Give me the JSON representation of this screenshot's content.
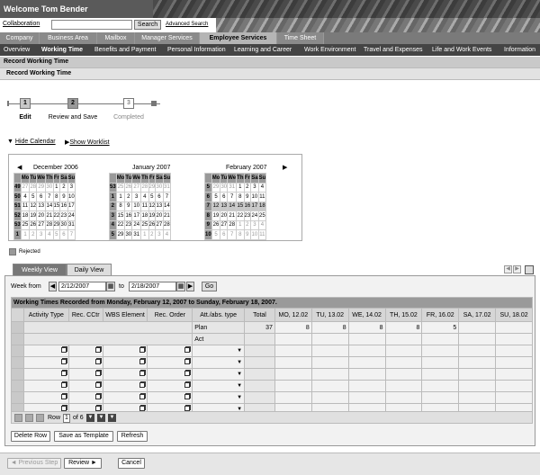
{
  "header": {
    "welcome": "Welcome Tom Bender"
  },
  "search": {
    "collaboration": "Collaboration",
    "button": "Search",
    "advanced": "Advanced Search"
  },
  "tabs": [
    "Company",
    "Business Area",
    "Mailbox",
    "Manager Services",
    "Employee Services",
    "Time Sheet"
  ],
  "subnav": [
    "Overview",
    "Working Time",
    "Benefits and Payment",
    "Personal Information",
    "Learning and Career",
    "Work Environment",
    "Travel and Expenses",
    "Life and Work Events",
    "Information"
  ],
  "page": {
    "title": "Record Working Time",
    "section": "Record Working Time"
  },
  "roadmap": {
    "steps": [
      {
        "num": "1",
        "label": "Edit"
      },
      {
        "num": "2",
        "label": "Review and Save"
      },
      {
        "num": "3",
        "label": "Completed"
      }
    ]
  },
  "links": {
    "hide_calendar": "Hide Calendar",
    "show_worklist": "Show Worklist"
  },
  "calendar": {
    "days": [
      "Mo",
      "Tu",
      "We",
      "Th",
      "Fr",
      "Sa",
      "Su"
    ],
    "months": [
      {
        "name": "December 2006",
        "weeks": [
          [
            "49",
            "27",
            "28",
            "29",
            "30",
            "1",
            "2",
            "3"
          ],
          [
            "50",
            "4",
            "5",
            "6",
            "7",
            "8",
            "9",
            "10"
          ],
          [
            "51",
            "11",
            "12",
            "13",
            "14",
            "15",
            "16",
            "17"
          ],
          [
            "52",
            "18",
            "19",
            "20",
            "21",
            "22",
            "23",
            "24"
          ],
          [
            "53",
            "25",
            "26",
            "27",
            "28",
            "29",
            "30",
            "31"
          ],
          [
            "1",
            "1",
            "2",
            "3",
            "4",
            "5",
            "6",
            "7"
          ]
        ]
      },
      {
        "name": "January 2007",
        "weeks": [
          [
            "53",
            "25",
            "26",
            "27",
            "28",
            "29",
            "30",
            "31"
          ],
          [
            "1",
            "1",
            "2",
            "3",
            "4",
            "5",
            "6",
            "7"
          ],
          [
            "2",
            "8",
            "9",
            "10",
            "11",
            "12",
            "13",
            "14"
          ],
          [
            "3",
            "15",
            "16",
            "17",
            "18",
            "19",
            "20",
            "21"
          ],
          [
            "4",
            "22",
            "23",
            "24",
            "25",
            "26",
            "27",
            "28"
          ],
          [
            "5",
            "29",
            "30",
            "31",
            "1",
            "2",
            "3",
            "4"
          ]
        ]
      },
      {
        "name": "February 2007",
        "weeks": [
          [
            "5",
            "29",
            "30",
            "31",
            "1",
            "2",
            "3",
            "4"
          ],
          [
            "6",
            "5",
            "6",
            "7",
            "8",
            "9",
            "10",
            "11"
          ],
          [
            "7",
            "12",
            "13",
            "14",
            "15",
            "16",
            "17",
            "18"
          ],
          [
            "8",
            "19",
            "20",
            "21",
            "22",
            "23",
            "24",
            "25"
          ],
          [
            "9",
            "26",
            "27",
            "28",
            "1",
            "2",
            "3",
            "4"
          ],
          [
            "10",
            "5",
            "6",
            "7",
            "8",
            "9",
            "10",
            "11"
          ]
        ]
      }
    ],
    "legend": "Rejected"
  },
  "view_tabs": [
    "Weekly View",
    "Daily View"
  ],
  "week": {
    "label_from": "Week from",
    "from": "2/12/2007",
    "label_to": "to",
    "to": "2/18/2007",
    "go": "Go"
  },
  "grid": {
    "title": "Working Times Recorded from Monday, February 12, 2007 to Sunday, February 18, 2007.",
    "columns": [
      "Activity Type",
      "Rec. CCtr",
      "WBS Element",
      "Rec. Order",
      "Att./abs. type",
      "Total",
      "MO, 12.02",
      "TU, 13.02",
      "WE, 14.02",
      "TH, 15.02",
      "FR, 16.02",
      "SA, 17.02",
      "SU, 18.02"
    ],
    "plan": {
      "label": "Plan",
      "values": [
        "37",
        "8",
        "8",
        "8",
        "8",
        "5",
        "",
        ""
      ]
    },
    "act": {
      "label": "Act"
    },
    "pager": {
      "row_label": "Row",
      "row": "1",
      "of": "of 6"
    }
  },
  "buttons": {
    "delete_row": "Delete Row",
    "save_template": "Save as Template",
    "refresh": "Refresh"
  },
  "nav": {
    "previous": "◄ Previous Step",
    "review": "Review ►",
    "cancel": "Cancel"
  }
}
